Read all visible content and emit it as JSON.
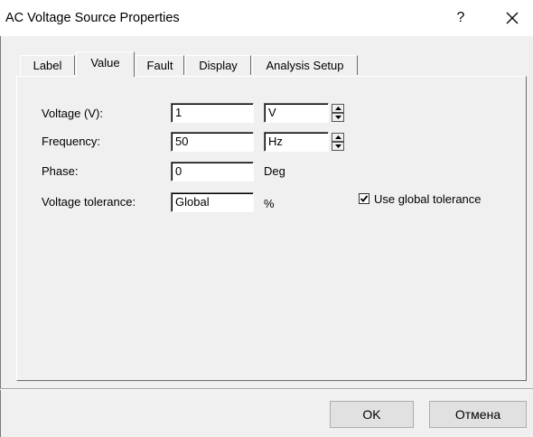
{
  "window": {
    "title": "AC Voltage Source Properties",
    "help_label": "?"
  },
  "tabs": [
    {
      "label": "Label",
      "active": false
    },
    {
      "label": "Value",
      "active": true
    },
    {
      "label": "Fault",
      "active": false
    },
    {
      "label": "Display",
      "active": false
    },
    {
      "label": "Analysis Setup",
      "active": false
    }
  ],
  "form": {
    "voltage": {
      "label": "Voltage (V):",
      "value": "1",
      "unit": "V"
    },
    "frequency": {
      "label": "Frequency:",
      "value": "50",
      "unit": "Hz"
    },
    "phase": {
      "label": "Phase:",
      "value": "0",
      "unit": "Deg"
    },
    "tolerance": {
      "label": "Voltage tolerance:",
      "value": "Global",
      "unit": "%"
    },
    "use_global": {
      "label": "Use global tolerance",
      "checked": true
    }
  },
  "buttons": {
    "ok": "OK",
    "cancel": "Отмена"
  },
  "colors": {
    "dialog_bg": "#f0f0f0",
    "title_bg": "#ffffff"
  }
}
